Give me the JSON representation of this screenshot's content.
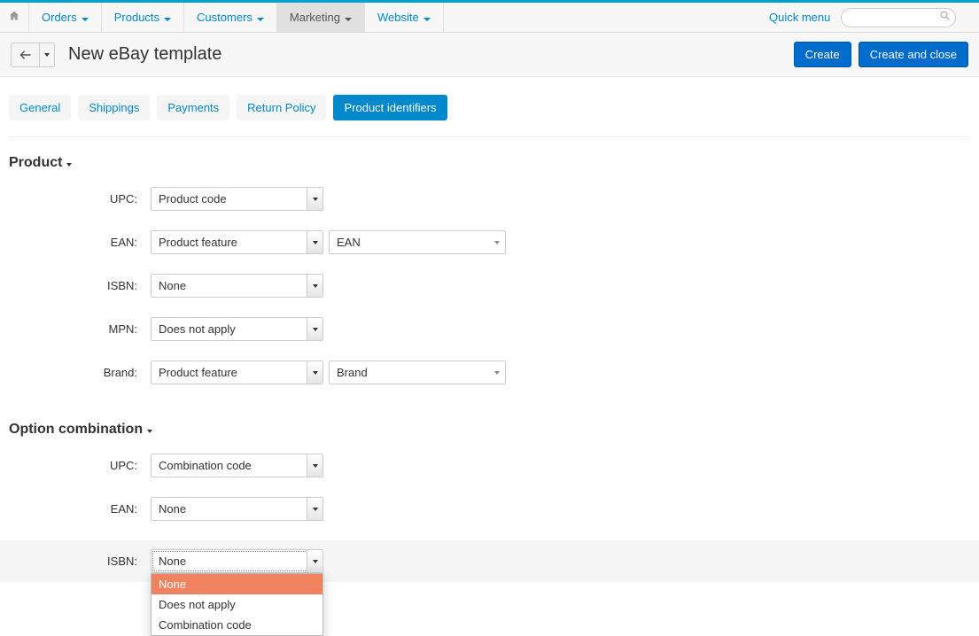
{
  "nav": {
    "items": [
      {
        "label": "Orders"
      },
      {
        "label": "Products"
      },
      {
        "label": "Customers"
      },
      {
        "label": "Marketing"
      },
      {
        "label": "Website"
      }
    ],
    "quick_menu": "Quick menu",
    "search_placeholder": ""
  },
  "title": "New eBay template",
  "buttons": {
    "create": "Create",
    "create_and_close": "Create and close"
  },
  "tabs": [
    {
      "label": "General"
    },
    {
      "label": "Shippings"
    },
    {
      "label": "Payments"
    },
    {
      "label": "Return Policy"
    },
    {
      "label": "Product identifiers"
    }
  ],
  "sections": {
    "product": {
      "title": "Product",
      "fields": {
        "upc": {
          "label": "UPC:",
          "value": "Product code"
        },
        "ean": {
          "label": "EAN:",
          "value": "Product feature",
          "secondary": "EAN"
        },
        "isbn": {
          "label": "ISBN:",
          "value": "None"
        },
        "mpn": {
          "label": "MPN:",
          "value": "Does not apply"
        },
        "brand": {
          "label": "Brand:",
          "value": "Product feature",
          "secondary": "Brand"
        }
      }
    },
    "option_combination": {
      "title": "Option combination",
      "fields": {
        "upc": {
          "label": "UPC:",
          "value": "Combination code"
        },
        "ean": {
          "label": "EAN:",
          "value": "None"
        },
        "isbn": {
          "label": "ISBN:",
          "value": "None",
          "options": [
            "None",
            "Does not apply",
            "Combination code"
          ]
        }
      }
    }
  }
}
